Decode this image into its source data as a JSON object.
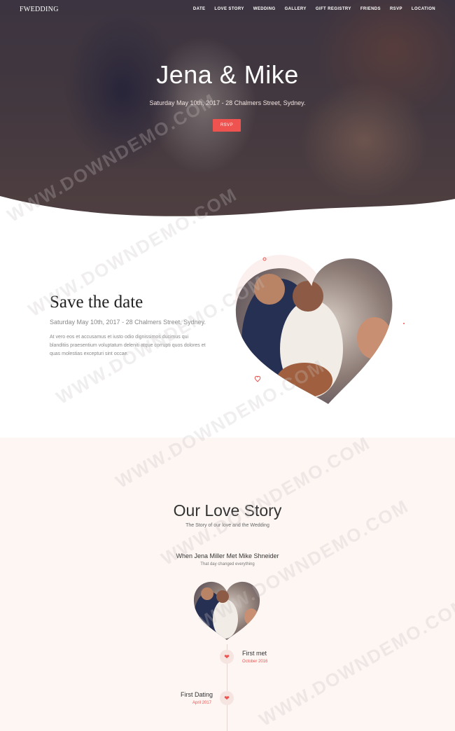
{
  "brand": "FWEDDING",
  "nav": [
    "DATE",
    "LOVE STORY",
    "WEDDING",
    "GALLERY",
    "GIFT REGISTRY",
    "FRIENDS",
    "RSVP",
    "LOCATION"
  ],
  "hero": {
    "title": "Jena & Mike",
    "subtitle": "Saturday May 10th, 2017 - 28 Chalmers Street, Sydney.",
    "button": "RSVP"
  },
  "save": {
    "title": "Save the date",
    "date": "Saturday May 10th, 2017 - 28 Chalmers Street, Sydney.",
    "text": "At vero eos et accusamus et iusto odio dignissimos ducimus qui blanditiis praesentium voluptatum deleniti atque corrupti quos dolores et quas molestias excepturi sint occae."
  },
  "story": {
    "title": "Our Love Story",
    "subtitle": "The Story of our love and the Wedding",
    "met_title": "When Jena Miller Met Mike Shneider",
    "met_subtitle": "That day changed everything",
    "timeline": [
      {
        "title": "First met",
        "date": "October 2016"
      },
      {
        "title": "First Dating",
        "date": "April 2017"
      }
    ]
  },
  "watermark": "WWW.DOWNDEMO.COM",
  "colors": {
    "accent": "#ef5350",
    "soft_bg": "#fdf6f3"
  },
  "icons": {
    "heart": "heart-icon"
  }
}
